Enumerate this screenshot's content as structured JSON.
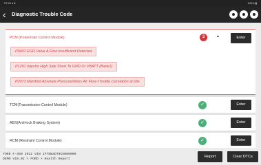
{
  "status_bar": {
    "left": "07:20 ▾ ♥",
    "right": "100% ▮"
  },
  "header": {
    "back": "‹",
    "title": "Diagnostic Trouble Code"
  },
  "modules": [
    {
      "label": "PCM (Powertrain Control Module)",
      "count": "3",
      "enter_label": "Enter",
      "dtcs": [
        "P0401 EGR Valve A Flow Insufficient Detected",
        "P1291 Injector High Side Short To GND Or VBATT (Bank1)",
        "P2073 Manifold Absolute Pressure/Mass Air Flow-Throttle correlation at idle"
      ]
    },
    {
      "label": "TCM(Transmission Control Module)",
      "enter_label": "Enter"
    },
    {
      "label": "ABS(Anti-lock Braking System)",
      "enter_label": "Enter"
    },
    {
      "label": "RCM (Restraint Control Module)",
      "enter_label": "Enter"
    }
  ],
  "footer": {
    "vehicle_info": "FORD  F-350  2012  VIN  1FT8W3DT9CEB00000",
    "path": "DEMO V10.02 > FORD > Health Report",
    "report_label": "Report",
    "clear_label": "Clear DTCs"
  }
}
